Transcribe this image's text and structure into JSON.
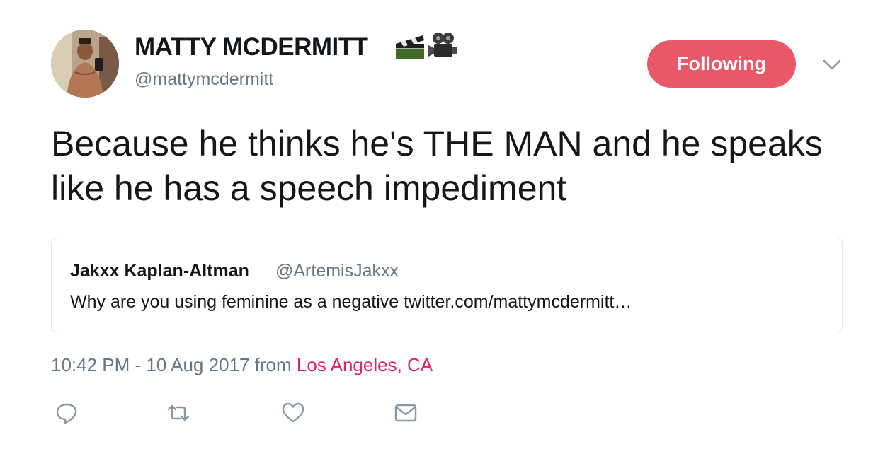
{
  "author": {
    "display_name": "MATTY MCDERMITT",
    "name_emojis": [
      "clapper-board-icon",
      "movie-camera-icon"
    ],
    "handle": "@mattymcdermitt"
  },
  "follow_button": {
    "label": "Following",
    "color": "#e95769"
  },
  "tweet": {
    "text": "Because he thinks he's THE MAN and he speaks like he has a speech impediment"
  },
  "quoted_tweet": {
    "name": "Jakxx Kaplan-Altman",
    "handle": "@ArtemisJakxx",
    "text": "Why are you using feminine as a negative twitter.com/mattymcdermitt…"
  },
  "meta": {
    "time_date": "10:42 PM - 10 Aug 2017",
    "from_label": "from",
    "location": "Los Angeles, CA",
    "location_color": "#e0245e"
  },
  "actions": [
    "reply-icon",
    "retweet-icon",
    "like-icon",
    "direct-message-icon"
  ]
}
